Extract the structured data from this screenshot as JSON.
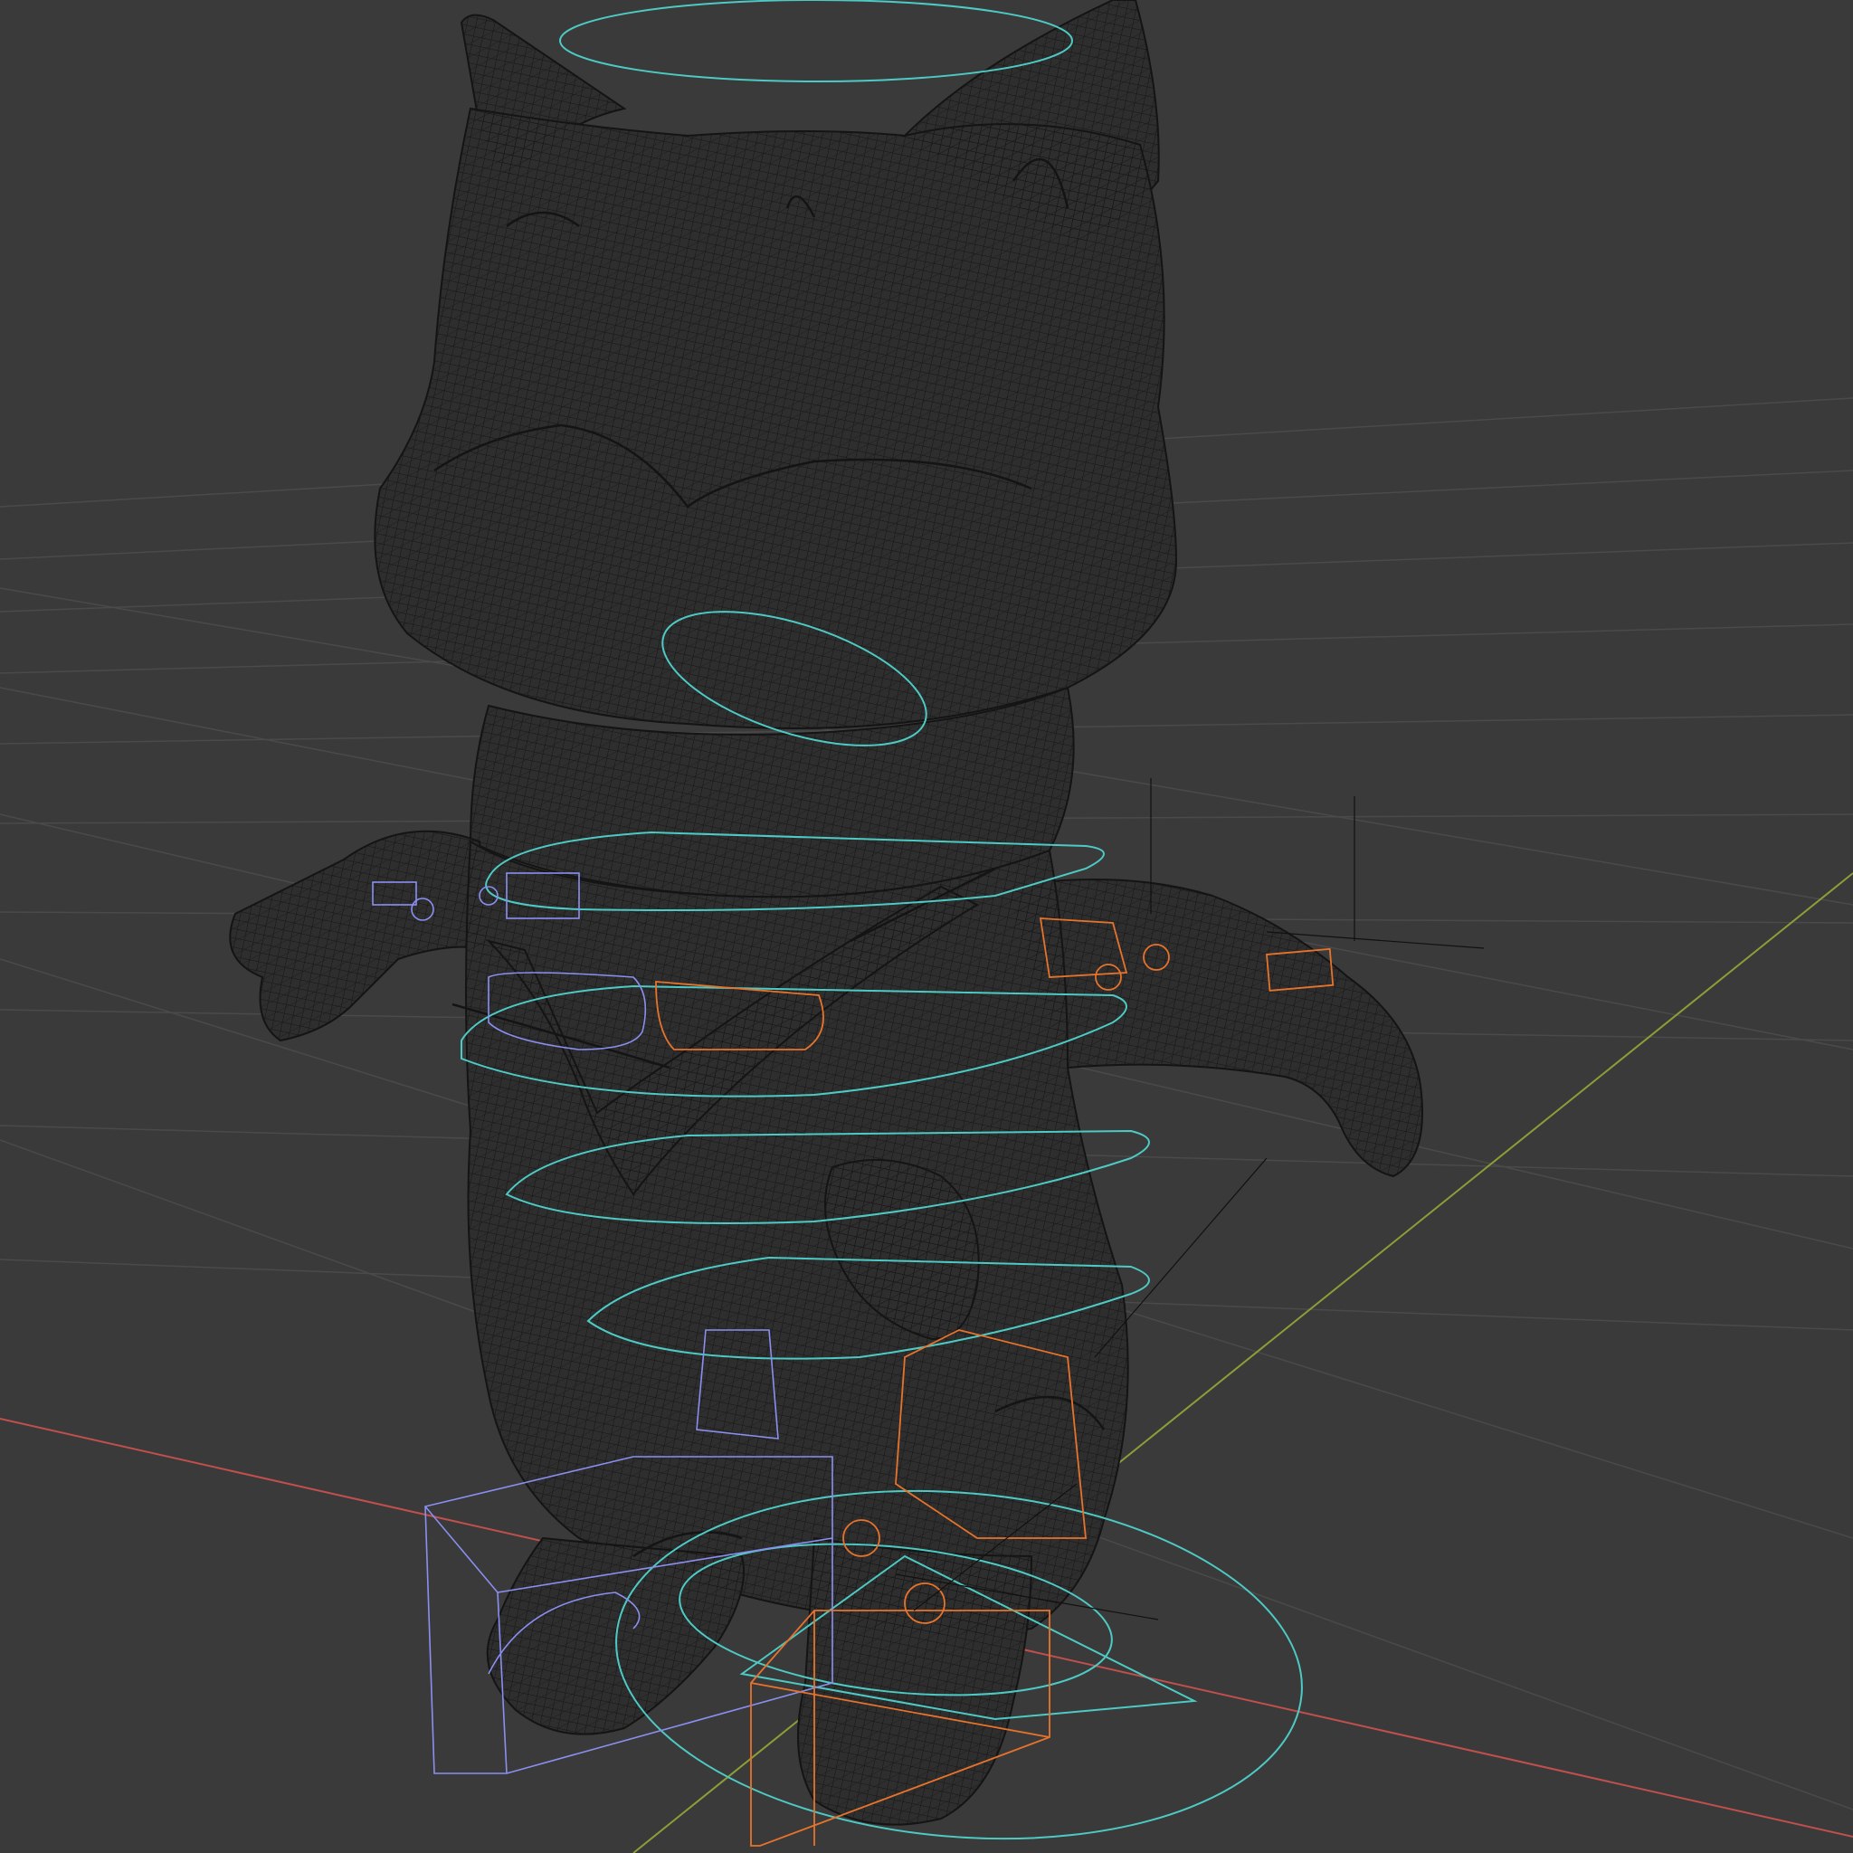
{
  "viewport": {
    "mode": "wireframe",
    "background_color": "#3a3a3a",
    "grid_color": "#4a4a4a",
    "x_axis_color": "#c0504d",
    "y_axis_color": "#8aa037",
    "mesh_color": "#141414",
    "mesh_fill_color": "#2e2e2e",
    "control_color": "#4ecac4",
    "left_bone_color": "#8a8ff0",
    "right_bone_color": "#e6732c",
    "empty_color": "#111111"
  },
  "scene": {
    "character": "cat-character-mesh",
    "controls": [
      "root-control",
      "foot-control-left",
      "foot-control-right",
      "torso-control",
      "hip-control",
      "head-control",
      "neck-control"
    ]
  }
}
